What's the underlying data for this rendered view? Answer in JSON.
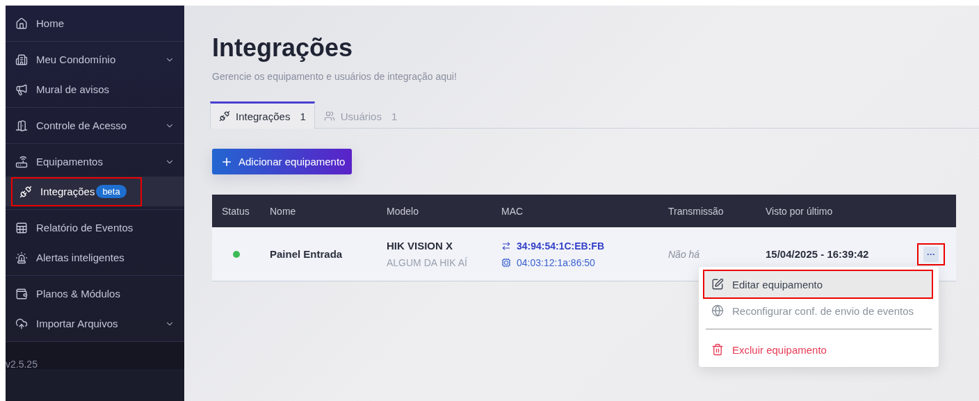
{
  "sidebar": {
    "groups": [
      {
        "items": [
          {
            "label": "Home",
            "expandable": false,
            "selected": false,
            "highlighted": false
          }
        ]
      },
      {
        "items": [
          {
            "label": "Meu Condomínio",
            "expandable": true,
            "selected": false,
            "highlighted": false
          },
          {
            "label": "Mural de avisos",
            "expandable": false,
            "selected": false,
            "highlighted": false
          }
        ]
      },
      {
        "items": [
          {
            "label": "Controle de Acesso",
            "expandable": true,
            "selected": false,
            "highlighted": false
          }
        ]
      },
      {
        "items": [
          {
            "label": "Equipamentos",
            "expandable": true,
            "selected": false,
            "highlighted": false
          },
          {
            "label": "Integrações",
            "badge": "beta",
            "expandable": false,
            "selected": true,
            "highlighted": true
          }
        ]
      },
      {
        "items": [
          {
            "label": "Relatório de Eventos",
            "expandable": false,
            "selected": false,
            "highlighted": false
          },
          {
            "label": "Alertas inteligentes",
            "expandable": false,
            "selected": false,
            "highlighted": false
          }
        ]
      },
      {
        "items": [
          {
            "label": "Planos & Módulos",
            "expandable": false,
            "selected": false,
            "highlighted": false
          },
          {
            "label": "Importar Arquivos",
            "expandable": true,
            "selected": false,
            "highlighted": false
          }
        ]
      }
    ],
    "version": "v2.5.25"
  },
  "page": {
    "title": "Integrações",
    "subtitle": "Gerencie os equipamento e usuários de integração aqui!"
  },
  "tabs": [
    {
      "label": "Integrações",
      "count": "1",
      "selected": true
    },
    {
      "label": "Usuários",
      "count": "1",
      "selected": false
    }
  ],
  "add_button": {
    "label": "Adicionar equipamento"
  },
  "table": {
    "columns": [
      "Status",
      "Nome",
      "Modelo",
      "MAC",
      "Transmissão",
      "Visto por último"
    ],
    "rows": [
      {
        "status": {
          "color": "#3dba55"
        },
        "name": "Painel Entrada",
        "model": "HIK VISION X",
        "model_detail": "ALGUM DA HIK AÍ",
        "mac": [
          {
            "kind": "primary",
            "value": "34:94:54:1C:EB:FB"
          },
          {
            "kind": "secondary",
            "value": "04:03:12:1a:86:50"
          }
        ],
        "transmission": "Não há",
        "last_seen": "15/04/2025 - 16:39:42",
        "actions": {
          "label": "···",
          "highlighted": true
        }
      }
    ]
  },
  "menu": {
    "items": [
      {
        "kind": "action",
        "label": "Editar equipamento",
        "disabled": false,
        "highlighted": true
      },
      {
        "kind": "action",
        "label": "Reconfigurar conf. de envio de eventos",
        "disabled": true,
        "highlighted": false
      },
      {
        "kind": "divider"
      },
      {
        "kind": "danger",
        "label": "Excluir equipamento",
        "disabled": false,
        "highlighted": false
      }
    ]
  }
}
